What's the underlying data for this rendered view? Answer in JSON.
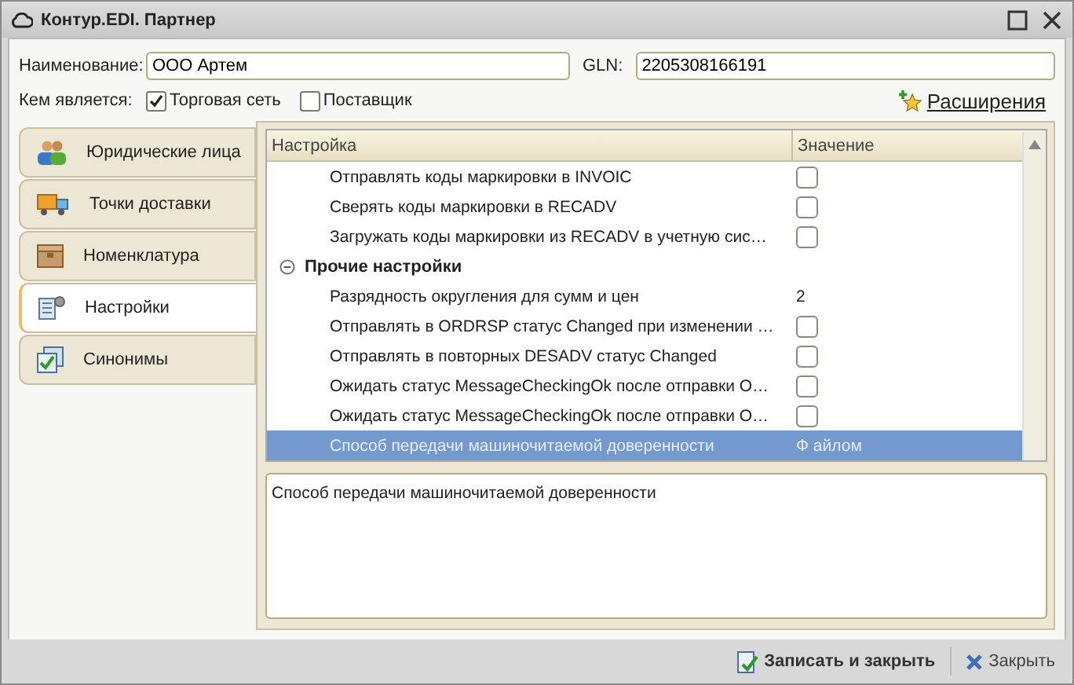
{
  "window": {
    "title": "Контур.EDI. Партнер"
  },
  "fields": {
    "name_label": "Наименование:",
    "name_value": "ООО Артем",
    "gln_label": "GLN:",
    "gln_value": "2205308166191"
  },
  "role": {
    "label": "Кем является:",
    "options": [
      {
        "label": "Торговая сеть",
        "checked": true
      },
      {
        "label": "Поставщик",
        "checked": false
      }
    ]
  },
  "extensions_link": "Расширения",
  "tabs": [
    {
      "label": "Юридические лица",
      "selected": false
    },
    {
      "label": "Точки доставки",
      "selected": false
    },
    {
      "label": "Номенклатура",
      "selected": false
    },
    {
      "label": "Настройки",
      "selected": true
    },
    {
      "label": "Синонимы",
      "selected": false
    }
  ],
  "table": {
    "columns": [
      "Настройка",
      "Значение"
    ],
    "rows": [
      {
        "kind": "check",
        "label": "Отправлять коды маркировки в INVOIC",
        "checked": false,
        "selected": false
      },
      {
        "kind": "check",
        "label": "Сверять коды маркировки в RECADV",
        "checked": false,
        "selected": false
      },
      {
        "kind": "check",
        "label": "Загружать коды маркировки из RECADV в учетную сис…",
        "checked": false,
        "selected": false
      },
      {
        "kind": "group",
        "label": "Прочие настройки",
        "expanded": true,
        "children": [
          {
            "kind": "text",
            "label": "Разрядность округления для сумм и цен",
            "value": "2",
            "selected": false
          },
          {
            "kind": "check",
            "label": "Отправлять в ORDRSP статус Changed при изменении …",
            "checked": false,
            "selected": false
          },
          {
            "kind": "check",
            "label": "Отправлять в повторных DESADV статус Changed",
            "checked": false,
            "selected": false
          },
          {
            "kind": "check",
            "label": "Ожидать статус MessageCheckingOk после отправки О…",
            "checked": false,
            "selected": false
          },
          {
            "kind": "check",
            "label": "Ожидать статус MessageCheckingOk после отправки О…",
            "checked": false,
            "selected": false
          },
          {
            "kind": "text",
            "label": "Способ передачи машиночитаемой доверенности",
            "value": "Ф айлом",
            "selected": true
          }
        ]
      }
    ]
  },
  "description": "Способ передачи машиночитаемой доверенности",
  "buttons": [
    {
      "label": "Записать и закрыть",
      "kind": "save"
    },
    {
      "label": "Закрыть",
      "kind": "close"
    }
  ]
}
